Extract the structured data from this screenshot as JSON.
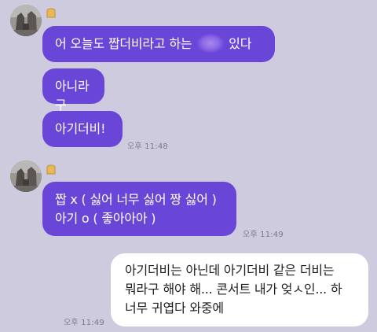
{
  "chat": {
    "group1": {
      "bread_icon": "bread-emoji",
      "msg1_before": "어 오늘도 짭더비라고 하는",
      "msg1_after": "있다",
      "msg2": "아니라구",
      "msg3": "아기더비!",
      "time": "오후 11:48"
    },
    "group2": {
      "bread_icon": "bread-emoji",
      "line1": "짭 x ( 싫어 너무 싫어 짱 싫어 )",
      "line2": "아기 o ( 좋아아아 )",
      "time": "오후 11:49"
    },
    "outgoing": {
      "line1": "아기더비는 아닌데 아기더비 같은 더비는",
      "line2": "뭐라구 해야 해... 콘서트 내가 엊ㅅ인... 하",
      "line3": "너무 귀엽다 와중에",
      "time": "오후 11:49"
    }
  },
  "colors": {
    "background": "#cfcbde",
    "incoming_bubble": "#6a46d8",
    "outgoing_bubble": "#ffffff"
  }
}
